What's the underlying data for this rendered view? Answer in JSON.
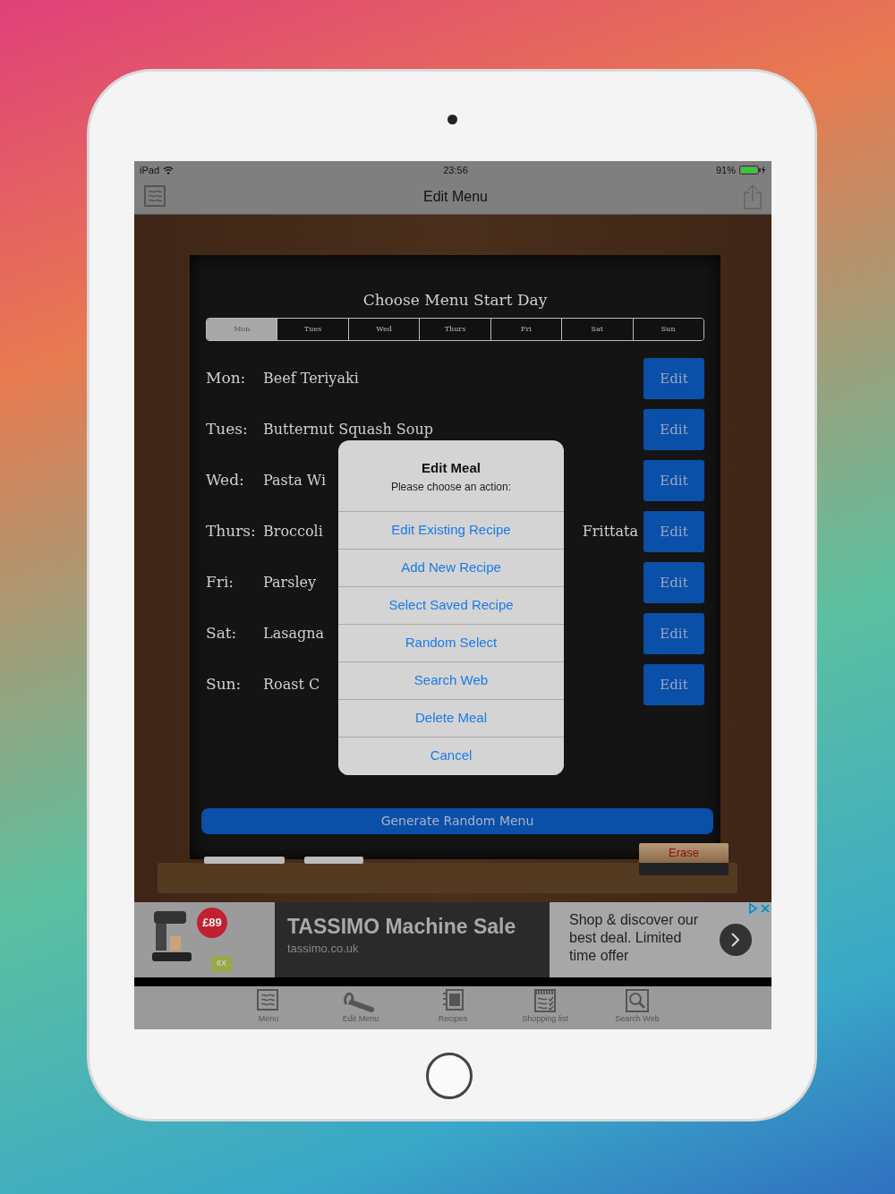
{
  "status_bar": {
    "device": "iPad",
    "time": "23:56",
    "battery": "91%"
  },
  "nav_bar": {
    "title": "Edit Menu"
  },
  "board": {
    "heading": "Choose Menu Start Day",
    "days": [
      {
        "label": "Mon",
        "selected": true
      },
      {
        "label": "Tues",
        "selected": false
      },
      {
        "label": "Wed",
        "selected": false
      },
      {
        "label": "Thurs",
        "selected": false
      },
      {
        "label": "Fri",
        "selected": false
      },
      {
        "label": "Sat",
        "selected": false
      },
      {
        "label": "Sun",
        "selected": false
      }
    ],
    "meals": [
      {
        "day": "Mon:",
        "meal": "Beef Teriyaki",
        "button": "Edit"
      },
      {
        "day": "Tues:",
        "meal": "Butternut Squash Soup",
        "button": "Edit"
      },
      {
        "day": "Wed:",
        "meal": "Pasta Wi",
        "button": "Edit"
      },
      {
        "day": "Thurs:",
        "meal": "Broccoli",
        "meal_end": "Frittata",
        "button": "Edit"
      },
      {
        "day": "Fri:",
        "meal": "Parsley",
        "button": "Edit"
      },
      {
        "day": "Sat:",
        "meal": "Lasagna",
        "button": "Edit"
      },
      {
        "day": "Sun:",
        "meal": "Roast C",
        "button": "Edit"
      }
    ],
    "generate_button": "Generate Random Menu",
    "eraser": "Erase"
  },
  "alert": {
    "title": "Edit Meal",
    "message": "Please choose an action:",
    "actions": [
      "Edit Existing Recipe",
      "Add New Recipe",
      "Select Saved Recipe",
      "Random Select",
      "Search Web",
      "Delete Meal",
      "Cancel"
    ]
  },
  "ad": {
    "price": "£89",
    "pack": "6X",
    "title": "TASSIMO Machine Sale",
    "url": "tassimo.co.uk",
    "text": "Shop & discover our best deal. Limited time offer"
  },
  "tab_bar": [
    {
      "label": "Menu",
      "kind": "menu"
    },
    {
      "label": "Edit Menu",
      "kind": "edit"
    },
    {
      "label": "Recipes",
      "kind": "recipes"
    },
    {
      "label": "Shopping list",
      "kind": "shopping"
    },
    {
      "label": "Search Web",
      "kind": "search"
    }
  ]
}
